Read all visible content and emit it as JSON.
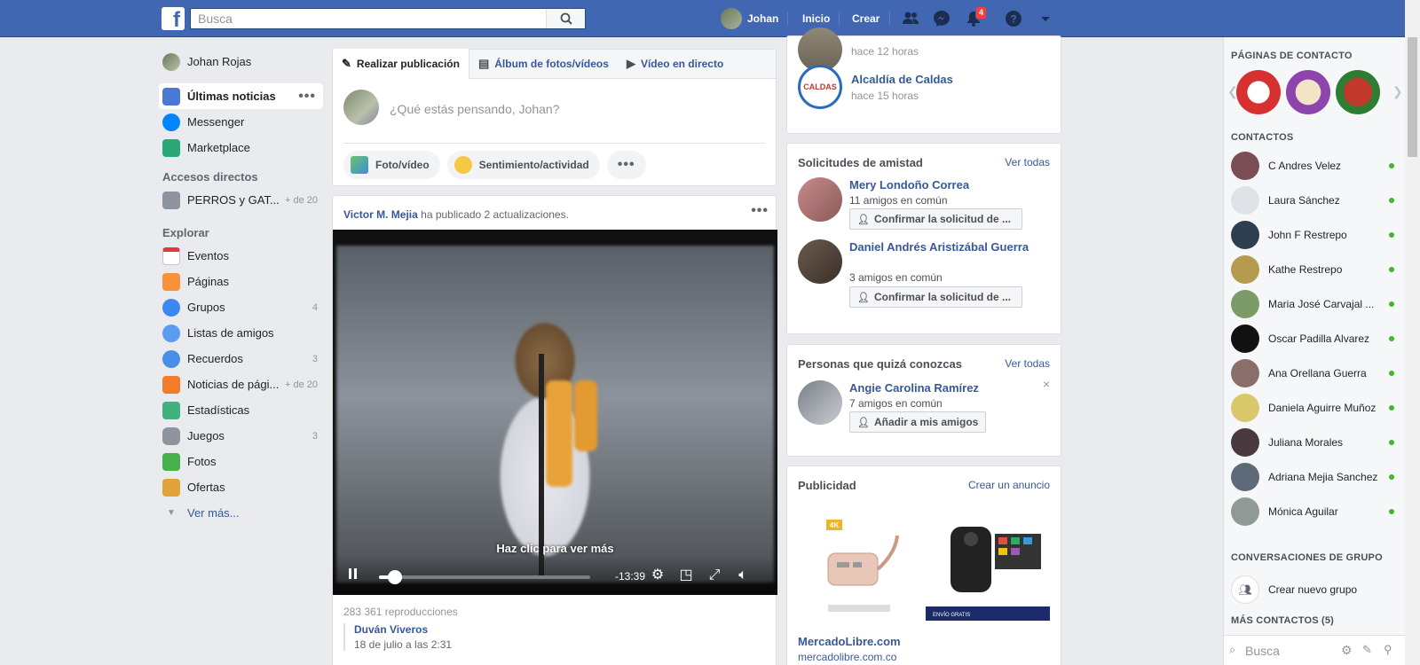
{
  "topbar": {
    "search_placeholder": "Busca",
    "profile_name": "Johan",
    "home_label": "Inicio",
    "create_label": "Crear",
    "notifications_count": "4"
  },
  "left_nav": {
    "user_name": "Johan Rojas",
    "items_main": [
      {
        "label": "Últimas noticias",
        "active": true
      },
      {
        "label": "Messenger"
      },
      {
        "label": "Marketplace"
      }
    ],
    "shortcuts_heading": "Accesos directos",
    "shortcut": {
      "label": "PERROS y GAT...",
      "count": "+ de 20"
    },
    "explore_heading": "Explorar",
    "explore_items": [
      {
        "label": "Eventos",
        "count": ""
      },
      {
        "label": "Páginas",
        "count": ""
      },
      {
        "label": "Grupos",
        "count": "4"
      },
      {
        "label": "Listas de amigos",
        "count": ""
      },
      {
        "label": "Recuerdos",
        "count": "3"
      },
      {
        "label": "Noticias de pági...",
        "count": "+ de 20"
      },
      {
        "label": "Estadísticas",
        "count": ""
      },
      {
        "label": "Juegos",
        "count": "3"
      },
      {
        "label": "Fotos",
        "count": ""
      },
      {
        "label": "Ofertas",
        "count": ""
      }
    ],
    "see_more": "Ver más..."
  },
  "composer": {
    "tabs": [
      "Realizar publicación",
      "Álbum de fotos/vídeos",
      "Vídeo en directo"
    ],
    "placeholder": "¿Qué estás pensando, Johan?",
    "actions": [
      "Foto/vídeo",
      "Sentimiento/actividad"
    ]
  },
  "post": {
    "author": "Victor M. Mejia",
    "header_suffix": "ha publicado 2 actualizaciones.",
    "video_cta": "Haz clic para ver más",
    "video_time": "-13:39",
    "video_progress": 0.05,
    "views": "283 361 reproducciones",
    "comment_author": "Duván Viveros",
    "comment_date": "18 de julio a las 2:31"
  },
  "pages_card": {
    "items": [
      {
        "title": "",
        "sub": "hace 12 horas"
      },
      {
        "title": "Alcaldía de Caldas",
        "sub": "hace 15 horas",
        "logo_text": "CALDAS"
      }
    ]
  },
  "requests": {
    "heading": "Solicitudes de amistad",
    "see_all": "Ver todas",
    "items": [
      {
        "name": "Mery Londoño Correa",
        "mutual": "11 amigos en común",
        "button": "Confirmar la solicitud de ..."
      },
      {
        "name": "Daniel Andrés Aristizábal Guerra",
        "mutual": "3 amigos en común",
        "button": "Confirmar la solicitud de ..."
      }
    ]
  },
  "pymk": {
    "heading": "Personas que quizá conozcas",
    "see_all": "Ver todas",
    "item": {
      "name": "Angie Carolina Ramírez",
      "mutual": "7 amigos en común",
      "button": "Añadir a mis amigos"
    },
    "close": "×"
  },
  "ads": {
    "heading": "Publicidad",
    "create": "Crear un anuncio",
    "name": "MercadoLibre.com",
    "domain": "mercadolibre.com.co",
    "badge": "4K",
    "ship_text": "ENVÍO GRATIS"
  },
  "chat": {
    "pages_heading": "PÁGINAS DE CONTACTO",
    "contacts_heading": "CONTACTOS",
    "contacts": [
      "C Andres Velez",
      "Laura Sánchez",
      "John F Restrepo",
      "Kathe Restrepo",
      "Maria José Carvajal ...",
      "Oscar Padilla Alvarez",
      "Ana Orellana Guerra",
      "Daniela Aguirre Muñoz",
      "Juliana Morales",
      "Adriana Mejia Sanchez",
      "Mónica Aguilar"
    ],
    "group_heading": "CONVERSACIONES DE GRUPO",
    "new_group": "Crear nuevo grupo",
    "more_heading": "MÁS CONTACTOS (5)",
    "search_placeholder": "Busca"
  },
  "colors": {
    "brand": "#4267b2",
    "link": "#365899",
    "online": "#42b72a",
    "badge": "#fa3e3e"
  }
}
